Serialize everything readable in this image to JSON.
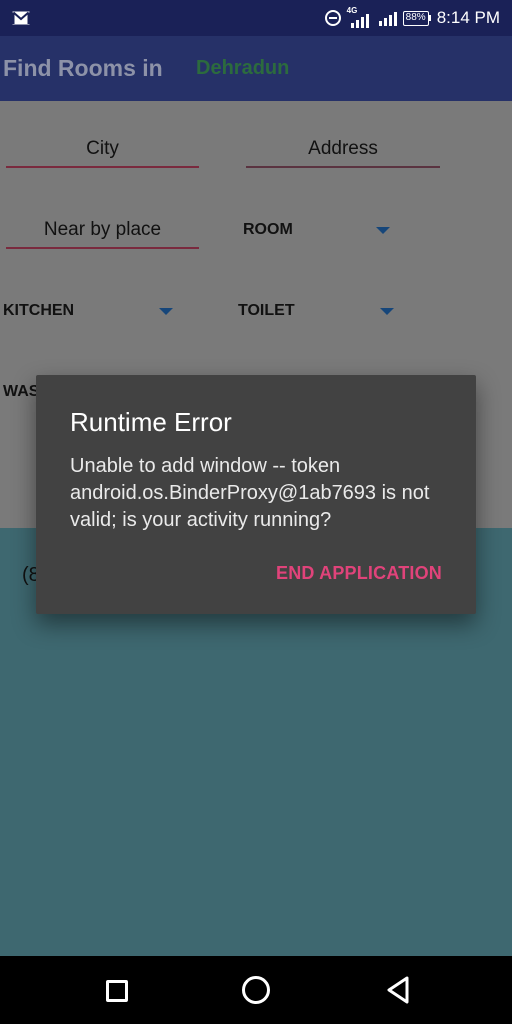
{
  "status_bar": {
    "time": "8:14 PM",
    "battery": "88%",
    "network": "4G",
    "icons": [
      "gmail-icon",
      "do-not-disturb-icon",
      "signal-icon",
      "signal-icon",
      "battery-icon"
    ]
  },
  "app_bar": {
    "title": "Find Rooms in",
    "city": "Dehradun"
  },
  "form": {
    "city_placeholder": "City",
    "address_placeholder": "Address",
    "nearby_placeholder": "Near by place",
    "room_label": "ROOM",
    "kitchen_label": "KITCHEN",
    "toilet_label": "TOILET",
    "washroom_label_partial": "WAS"
  },
  "results": {
    "count_partial": "(8"
  },
  "dialog": {
    "title": "Runtime Error",
    "message": "Unable to add window -- token android.os.BinderProxy@1ab7693 is not valid; is your activity running?",
    "button": "END APPLICATION"
  },
  "colors": {
    "status_bar": "#1a2157",
    "app_bar": "#263168",
    "accent_pink": "#e0437a",
    "dialog_bg": "#424242",
    "teal": "#3e6870"
  }
}
